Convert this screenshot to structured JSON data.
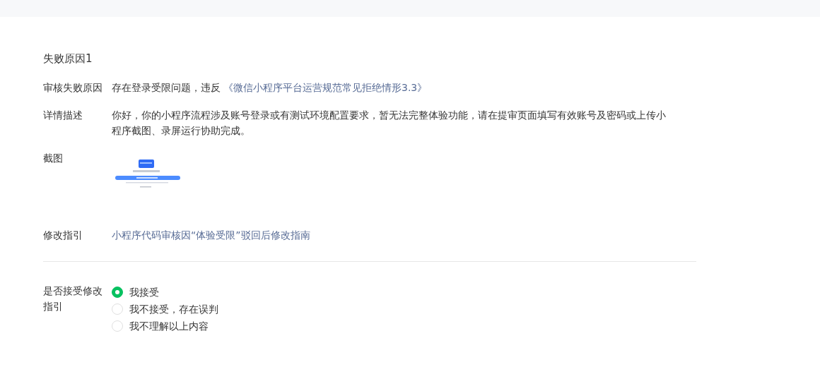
{
  "section_title": "失败原因1",
  "reason": {
    "label": "审核失败原因",
    "text": "存在登录受限问题，违反",
    "link": "《微信小程序平台运营规范常见拒绝情形3.3》"
  },
  "detail": {
    "label": "详情描述",
    "text": "你好，你的小程序流程涉及账号登录或有测试环境配置要求，暂无法完整体验功能，请在提审页面填写有效账号及密码或上传小程序截图、录屏运行协助完成。"
  },
  "screenshot": {
    "label": "截图",
    "kind": "picture"
  },
  "guide": {
    "label": "修改指引",
    "link": "小程序代码审核因“体验受限”驳回后修改指南"
  },
  "accept": {
    "label": "是否接受修改指引",
    "options": [
      {
        "label": "我接受",
        "selected": true
      },
      {
        "label": "我不接受，存在误判",
        "selected": false
      },
      {
        "label": "我不理解以上内容",
        "selected": false
      }
    ]
  }
}
